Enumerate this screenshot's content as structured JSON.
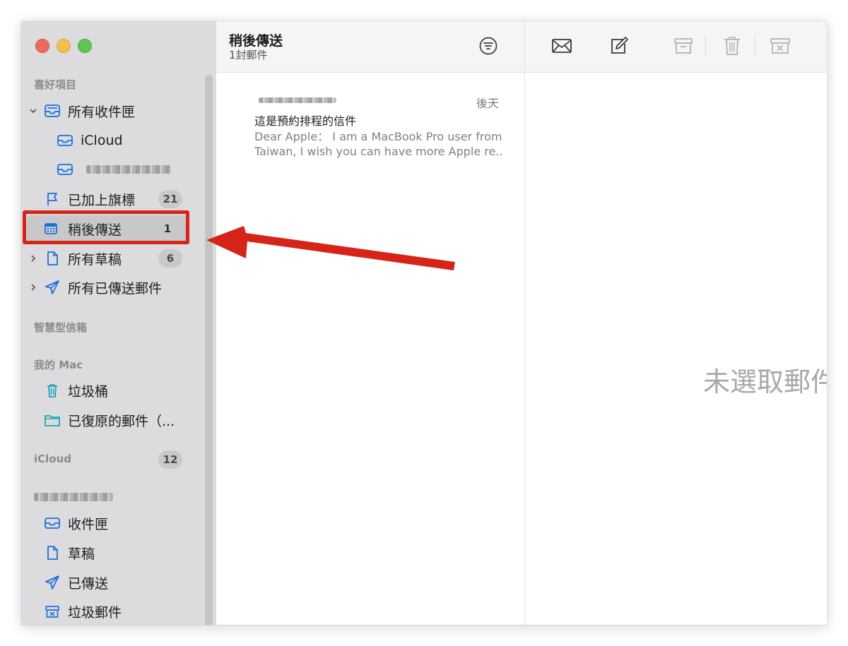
{
  "sidebar": {
    "favorites_header": "喜好項目",
    "smart_header": "智慧型信箱",
    "mymac_header": "我的 Mac",
    "icloud_header": "iCloud",
    "icloud_count": "12",
    "items": [
      {
        "label": "所有收件匣"
      },
      {
        "label": "iCloud"
      },
      {
        "label": "已加上旗標",
        "badge": "21"
      },
      {
        "label": "稍後傳送",
        "badge": "1"
      },
      {
        "label": "所有草稿",
        "badge": "6"
      },
      {
        "label": "所有已傳送郵件"
      }
    ],
    "mymac_items": [
      {
        "label": "垃圾桶"
      },
      {
        "label": "已復原的郵件（..."
      }
    ],
    "account_items": [
      {
        "label": "收件匣"
      },
      {
        "label": "草稿"
      },
      {
        "label": "已傳送"
      },
      {
        "label": "垃圾郵件"
      }
    ]
  },
  "list": {
    "title": "稍後傳送",
    "count": "1封郵件",
    "message": {
      "date": "後天",
      "subject": "這是預約排程的信件",
      "preview_line1": "Dear Apple： I am a MacBook Pro user from",
      "preview_line2": "Taiwan, I wish you can have more Apple re..."
    }
  },
  "viewer": {
    "empty_text": "未選取郵件"
  },
  "colors": {
    "annotation_red": "#d62418",
    "accent_blue": "#1a6fe0",
    "sidebar_bg": "#dcdcde"
  }
}
